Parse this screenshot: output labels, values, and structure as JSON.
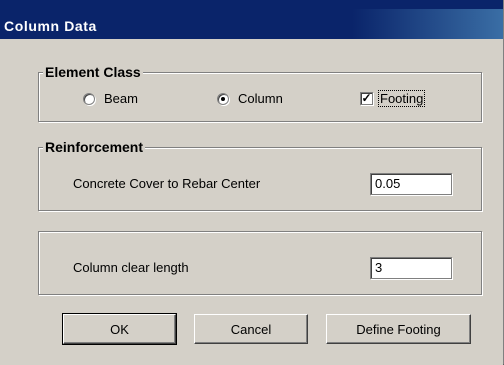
{
  "window": {
    "title": "Column Data"
  },
  "element_class": {
    "legend": "Element Class",
    "options": [
      {
        "label": "Beam",
        "checked": false
      },
      {
        "label": "Column",
        "checked": true
      }
    ],
    "footing": {
      "label": "Footing",
      "checked": true,
      "mark": "✓"
    }
  },
  "reinforcement": {
    "legend": "Reinforcement",
    "cover_label": "Concrete Cover to Rebar Center",
    "cover_value": "0.05"
  },
  "clear_length": {
    "label": "Column clear length",
    "value": "3"
  },
  "buttons": {
    "ok": "OK",
    "cancel": "Cancel",
    "define_footing": "Define Footing"
  }
}
